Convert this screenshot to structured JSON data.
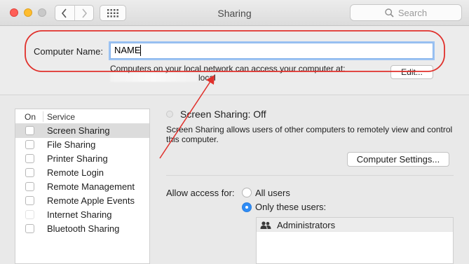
{
  "window": {
    "title": "Sharing"
  },
  "toolbar": {
    "search_placeholder": "Search"
  },
  "computer_name": {
    "label": "Computer Name:",
    "value": "NAME",
    "access_text": "Computers on your local network can access your computer at:",
    "local_suffix": "local",
    "edit_label": "Edit..."
  },
  "services": {
    "header_on": "On",
    "header_service": "Service",
    "items": [
      {
        "label": "Screen Sharing"
      },
      {
        "label": "File Sharing"
      },
      {
        "label": "Printer Sharing"
      },
      {
        "label": "Remote Login"
      },
      {
        "label": "Remote Management"
      },
      {
        "label": "Remote Apple Events"
      },
      {
        "label": "Internet Sharing"
      },
      {
        "label": "Bluetooth Sharing"
      }
    ]
  },
  "detail": {
    "status": "Screen Sharing: Off",
    "description": "Screen Sharing allows users of other computers to remotely view and control this computer.",
    "computer_settings_label": "Computer Settings...",
    "allow_access_label": "Allow access for:",
    "all_users_label": "All users",
    "only_these_users_label": "Only these users:",
    "users": [
      "Administrators"
    ]
  },
  "annotation_color": "#e0302b"
}
